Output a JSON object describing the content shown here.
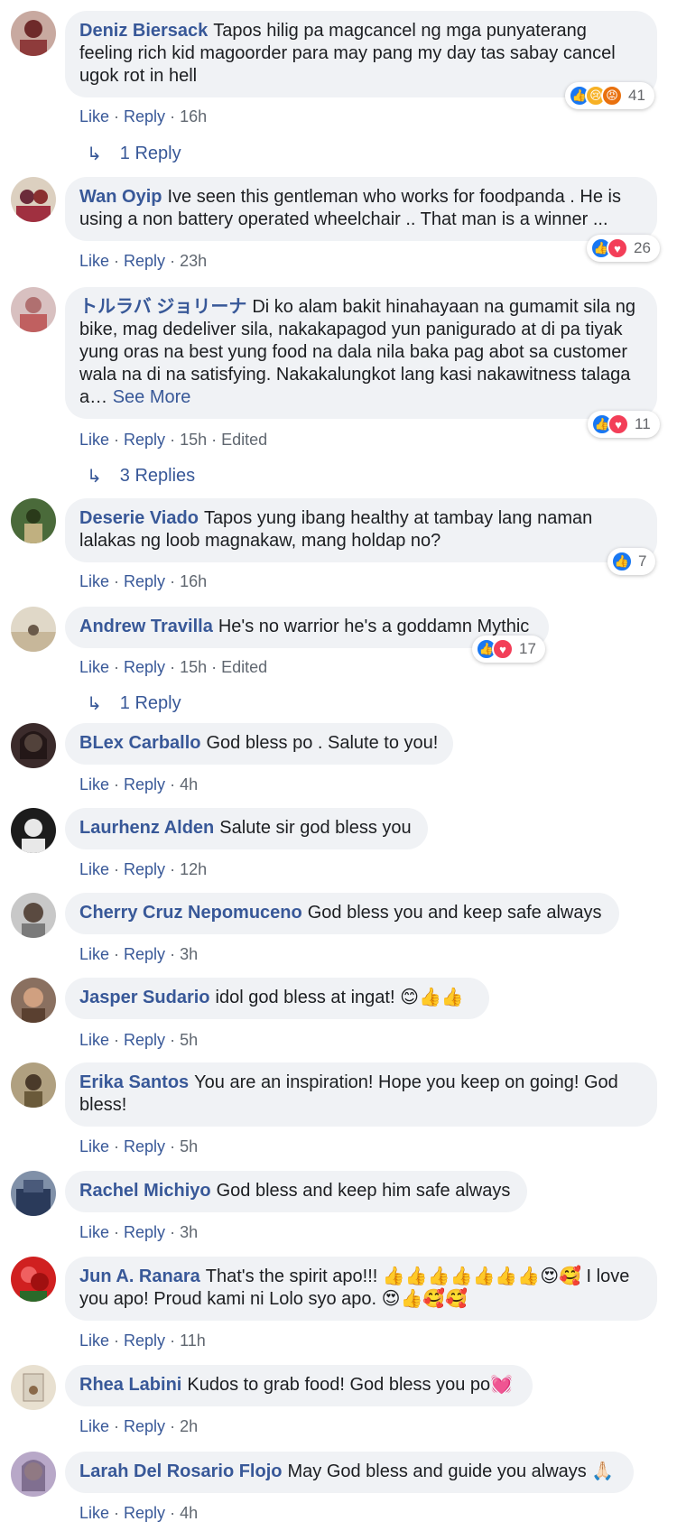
{
  "actions": {
    "like": "Like",
    "reply": "Reply",
    "separator": "·",
    "edited": "Edited"
  },
  "comments": [
    {
      "author": "Deniz Biersack",
      "text": "Tapos hilig pa magcancel ng mga punyaterang feeling rich kid magoorder para may pang my day tas sabay cancel ugok rot in hell",
      "time": "16h",
      "reaction_count": "41",
      "replies_label": "1 Reply",
      "avatar_color": "#8e3b3b"
    },
    {
      "author": "Wan Oyip",
      "text": "Ive seen this gentleman who works for foodpanda . He is using a non battery operated wheelchair .. That man is a winner ...",
      "time": "23h",
      "reaction_count": "26",
      "avatar_color": "#6b2b3a"
    },
    {
      "author": "トルラバ ジョリーナ",
      "text": "Di ko alam bakit hinahayaan na gumamit sila ng bike, mag dedeliver sila, nakakapagod yun panigurado at di pa tiyak yung oras na best yung food na dala nila baka pag abot sa customer wala na di na satisfying. Nakakalungkot lang kasi nakawitness talaga a…",
      "see_more": "See More",
      "time": "15h",
      "reaction_count": "11",
      "replies_label": "3 Replies",
      "avatar_color": "#b07070"
    },
    {
      "author": "Deserie Viado",
      "text": "Tapos yung ibang healthy at tambay lang naman lalakas ng loob magnakaw, mang holdap no?",
      "time": "16h",
      "reaction_count": "7",
      "avatar_color": "#3a5a2a"
    },
    {
      "author": "Andrew Travilla",
      "text": "He's no warrior he's a goddamn Mythic",
      "time": "15h",
      "reaction_count": "17",
      "replies_label": "1 Reply",
      "avatar_color": "#c7b79a"
    },
    {
      "author": "BLex Carballo",
      "text": "God bless po . Salute to you!",
      "time": "4h",
      "avatar_color": "#3b2b2b"
    },
    {
      "author": "Laurhenz Alden",
      "text": "Salute sir god bless you",
      "time": "12h",
      "avatar_color": "#1c1c1c"
    },
    {
      "author": "Cherry Cruz Nepomuceno",
      "text": "God bless you and keep safe always",
      "time": "3h",
      "avatar_color": "#7a7a7a"
    },
    {
      "author": "Jasper Sudario",
      "text": "idol god bless at ingat! 😊👍👍",
      "time": "5h",
      "avatar_color": "#5a4030"
    },
    {
      "author": "Erika Santos",
      "text": "You are an inspiration! Hope you keep on going! God bless!",
      "time": "5h",
      "avatar_color": "#6a5a3a"
    },
    {
      "author": "Rachel Michiyo",
      "text": "God bless and keep him safe always",
      "time": "3h",
      "avatar_color": "#2a3a5a"
    },
    {
      "author": "Jun A. Ranara",
      "text": "That's the spirit apo!!! 👍👍👍👍👍👍👍😍🥰 I love you apo! Proud kami ni Lolo syo apo. 😍👍🥰🥰",
      "time": "11h",
      "avatar_color": "#a02020"
    },
    {
      "author": "Rhea Labini",
      "text": "Kudos to grab food! God bless you po💓",
      "time": "2h",
      "avatar_color": "#d8d0c0"
    },
    {
      "author": "Larah Del Rosario Flojo",
      "text": "May God bless and guide you always 🙏🏻",
      "time": "4h",
      "avatar_color": "#7a6a8a"
    }
  ]
}
